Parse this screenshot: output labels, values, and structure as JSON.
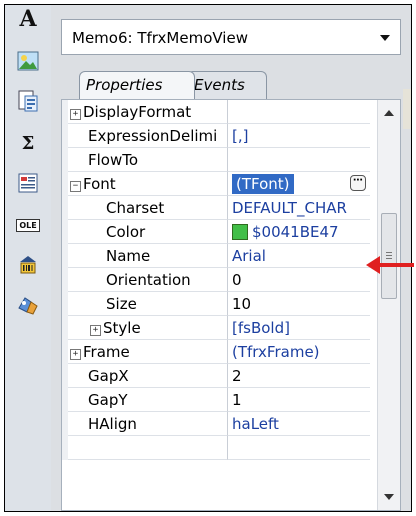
{
  "toolbar": {
    "tools": [
      {
        "icon": "text-tool-icon",
        "glyph": "A"
      },
      {
        "icon": "picture-tool-icon"
      },
      {
        "icon": "subreport-tool-icon"
      },
      {
        "icon": "sum-tool-icon",
        "glyph": "Σ"
      },
      {
        "icon": "richtext-tool-icon"
      },
      {
        "icon": "ole-tool-icon",
        "glyph": "OLE"
      },
      {
        "icon": "barcode-tool-icon"
      },
      {
        "icon": "chart-tool-icon"
      }
    ]
  },
  "object_selector": {
    "value": "Memo6: TfrxMemoView"
  },
  "tabs": [
    {
      "label": "Properties",
      "active": true
    },
    {
      "label": "Events",
      "active": false
    }
  ],
  "properties": [
    {
      "name": "DisplayFormat",
      "value": "",
      "expandable": true,
      "level": 0
    },
    {
      "name": "ExpressionDelimi",
      "value": "[,]",
      "expandable": false,
      "level": 0
    },
    {
      "name": "FlowTo",
      "value": "",
      "expandable": false,
      "level": 0
    },
    {
      "name": "Font",
      "value": "(TFont)",
      "expandable": true,
      "expanded": true,
      "level": 0,
      "selected": true
    },
    {
      "name": "Charset",
      "value": "DEFAULT_CHAR",
      "expandable": false,
      "level": 1
    },
    {
      "name": "Color",
      "value": "$0041BE47",
      "expandable": false,
      "level": 1,
      "swatch": "#41be47"
    },
    {
      "name": "Name",
      "value": "Arial",
      "expandable": false,
      "level": 1
    },
    {
      "name": "Orientation",
      "value": "0",
      "expandable": false,
      "level": 1
    },
    {
      "name": "Size",
      "value": "10",
      "expandable": false,
      "level": 1
    },
    {
      "name": "Style",
      "value": "[fsBold]",
      "expandable": true,
      "level": 1
    },
    {
      "name": "Frame",
      "value": "(TfrxFrame)",
      "expandable": true,
      "level": 0
    },
    {
      "name": "GapX",
      "value": "2",
      "expandable": false,
      "level": 0
    },
    {
      "name": "GapY",
      "value": "1",
      "expandable": false,
      "level": 0
    },
    {
      "name": "HAlign",
      "value": "haLeft",
      "expandable": false,
      "level": 0
    }
  ],
  "colors": {
    "selection": "#316ac5",
    "value_text": "#1c3fa0",
    "annotation_arrow": "#e02020",
    "color_swatch": "#41be47"
  }
}
